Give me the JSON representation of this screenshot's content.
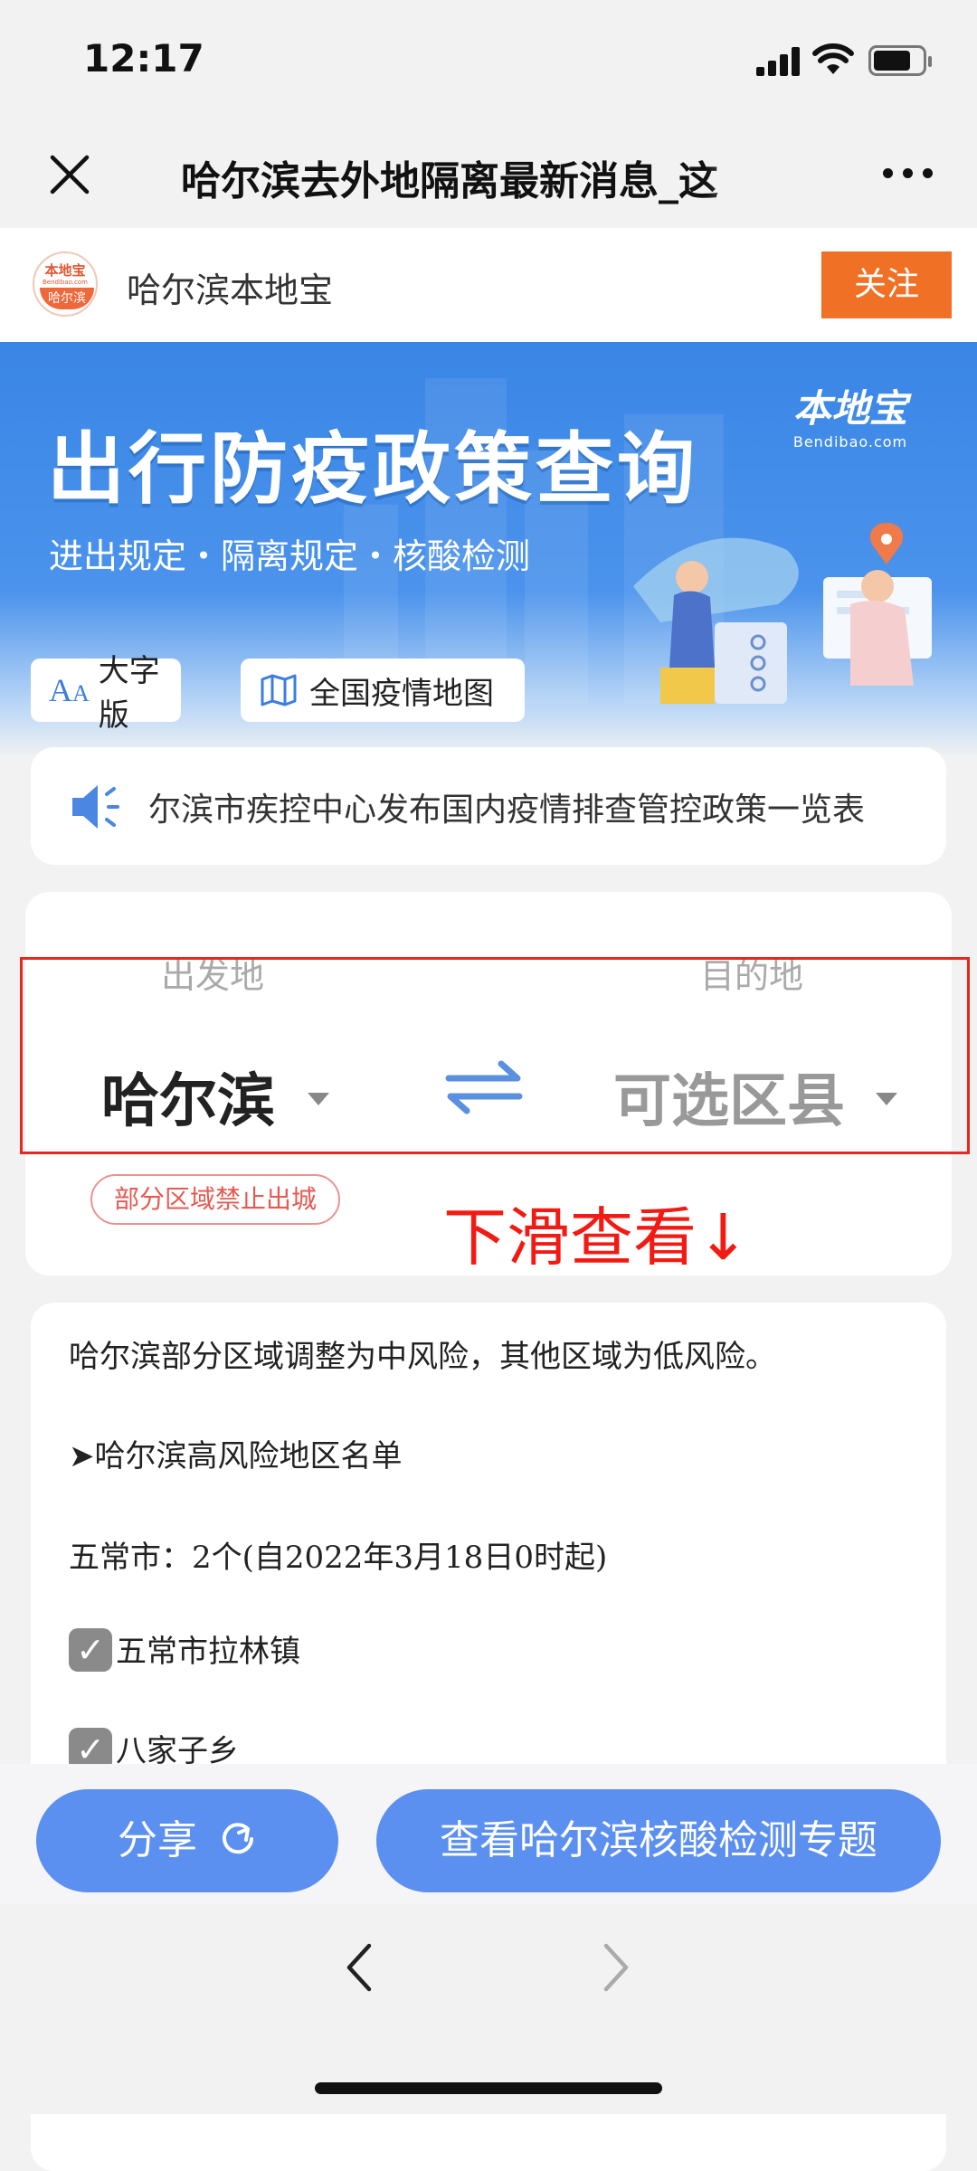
{
  "status_bar": {
    "time": "12:17"
  },
  "nav": {
    "title": "哈尔滨去外地隔离最新消息_这"
  },
  "account": {
    "logo": {
      "top": "本地宝",
      "mid": "Bendibao.com",
      "bottom": "哈尔滨"
    },
    "name": "哈尔滨本地宝",
    "follow_label": "关注"
  },
  "banner": {
    "title": "出行防疫政策查询",
    "subtitle": "进出规定・隔离规定・核酸检测",
    "brand": "本地宝",
    "brand_url": "Bendibao.com",
    "large_font_label": "大字版",
    "map_label": "全国疫情地图"
  },
  "notice": {
    "text": "尔滨市疾控中心发布国内疫情排查管控政策一览表"
  },
  "selector": {
    "from_label": "出发地",
    "from_value": "哈尔滨",
    "to_label": "目的地",
    "to_value": "可选区县",
    "badge": "部分区域禁止出城",
    "annotation": "下滑查看↓"
  },
  "content": {
    "lines": [
      "哈尔滨部分区域调整为中风险，其他区域为低风险。",
      "➤哈尔滨高风险地区名单",
      "五常市：2个(自2022年3月18日0时起)"
    ],
    "checked_items": [
      "五常市拉林镇",
      "八家子乡"
    ]
  },
  "bottom_bar": {
    "share_label": "分享",
    "topic_label": "查看哈尔滨核酸检测专题"
  },
  "colors": {
    "accent_blue": "#5b8ff0",
    "follow_orange": "#f07025",
    "annotation_red": "#e8281e"
  }
}
